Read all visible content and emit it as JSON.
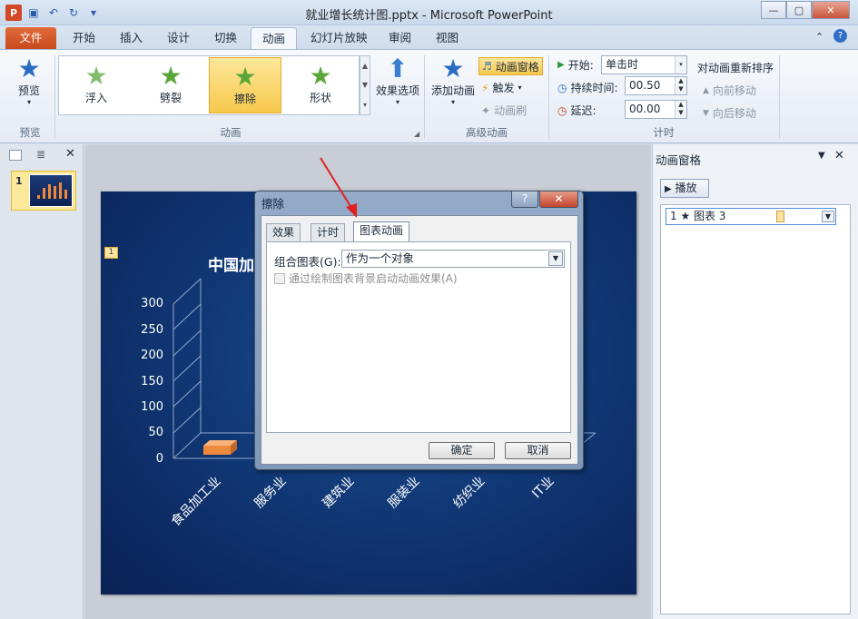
{
  "window": {
    "title": "就业增长统计图.pptx - Microsoft PowerPoint",
    "app_icon": "P"
  },
  "tabs": [
    "文件",
    "开始",
    "插入",
    "设计",
    "切换",
    "动画",
    "幻灯片放映",
    "审阅",
    "视图"
  ],
  "ribbon": {
    "preview": {
      "label": "预览",
      "group": "预览"
    },
    "gallery": [
      {
        "label": "浮入"
      },
      {
        "label": "劈裂"
      },
      {
        "label": "擦除"
      },
      {
        "label": "形状"
      }
    ],
    "effect_options": "效果选项",
    "animation_group": "动画",
    "add_animation": "添加动画",
    "animation_pane": "动画窗格",
    "trigger": "触发",
    "anim_painter": "动画刷",
    "advanced_group": "高级动画",
    "start_label": "开始:",
    "start_value": "单击时",
    "duration_label": "持续时间:",
    "duration_value": "00.50",
    "delay_label": "延迟:",
    "delay_value": "00.00",
    "timing_group": "计时",
    "reorder_title": "对动画重新排序",
    "move_earlier": "向前移动",
    "move_later": "向后移动"
  },
  "left_panel": {
    "slide_number": "1"
  },
  "slide": {
    "title": "中国加",
    "badge": "1",
    "y_ticks": [
      "300",
      "250",
      "200",
      "150",
      "100",
      "50",
      "0"
    ],
    "x_labels": [
      "食品加工业",
      "服务业",
      "建筑业",
      "服装业",
      "纺织业",
      "IT业"
    ]
  },
  "anim_pane": {
    "title": "动画窗格",
    "play": "播放",
    "item": "1 ★ 图表 3"
  },
  "dialog": {
    "title": "擦除",
    "help": "?",
    "tabs": [
      "效果",
      "计时",
      "图表动画"
    ],
    "group_label": "组合图表(G):",
    "group_value": "作为一个对象",
    "checkbox_label": "通过绘制图表背景启动动画效果(A)",
    "ok": "确定",
    "cancel": "取消"
  }
}
